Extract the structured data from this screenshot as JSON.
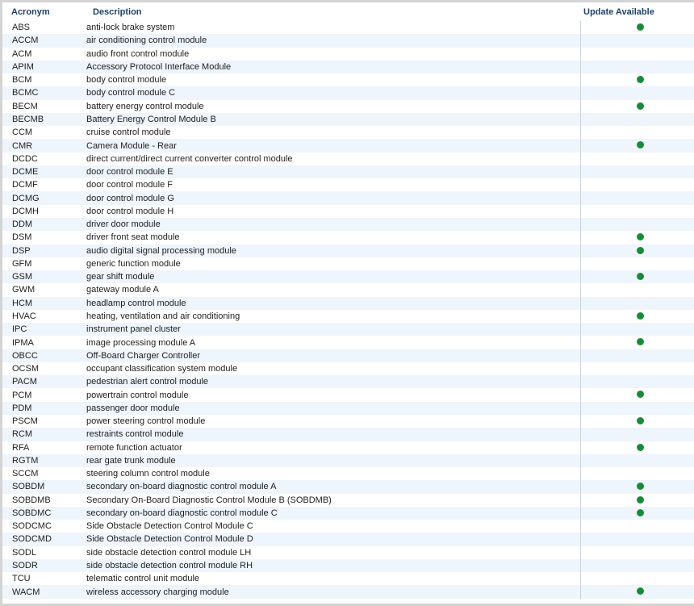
{
  "columns": {
    "acronym": "Acronym",
    "description": "Description",
    "update": "Update Available"
  },
  "colors": {
    "update_dot": "#1a8a3a",
    "header_text": "#1f3f66",
    "alt_row": "#eef5fc"
  },
  "rows": [
    {
      "acronym": "ABS",
      "description": "anti-lock brake system",
      "update": true
    },
    {
      "acronym": "ACCM",
      "description": "air conditioning control module",
      "update": false
    },
    {
      "acronym": "ACM",
      "description": "audio front control module",
      "update": false
    },
    {
      "acronym": "APIM",
      "description": "Accessory Protocol Interface Module",
      "update": false
    },
    {
      "acronym": "BCM",
      "description": "body control module",
      "update": true
    },
    {
      "acronym": "BCMC",
      "description": "body control module C",
      "update": false
    },
    {
      "acronym": "BECM",
      "description": "battery energy control module",
      "update": true
    },
    {
      "acronym": "BECMB",
      "description": "Battery Energy Control Module B",
      "update": false
    },
    {
      "acronym": "CCM",
      "description": "cruise control module",
      "update": false
    },
    {
      "acronym": "CMR",
      "description": "Camera Module - Rear",
      "update": true
    },
    {
      "acronym": "DCDC",
      "description": "direct current/direct current converter control module",
      "update": false
    },
    {
      "acronym": "DCME",
      "description": "door control module E",
      "update": false
    },
    {
      "acronym": "DCMF",
      "description": "door control module F",
      "update": false
    },
    {
      "acronym": "DCMG",
      "description": "door control module G",
      "update": false
    },
    {
      "acronym": "DCMH",
      "description": "door control module H",
      "update": false
    },
    {
      "acronym": "DDM",
      "description": "driver door module",
      "update": false
    },
    {
      "acronym": "DSM",
      "description": "driver front seat module",
      "update": true
    },
    {
      "acronym": "DSP",
      "description": "audio digital signal processing module",
      "update": true
    },
    {
      "acronym": "GFM",
      "description": "generic function module",
      "update": false
    },
    {
      "acronym": "GSM",
      "description": "gear shift module",
      "update": true
    },
    {
      "acronym": "GWM",
      "description": "gateway module A",
      "update": false
    },
    {
      "acronym": "HCM",
      "description": "headlamp control module",
      "update": false
    },
    {
      "acronym": "HVAC",
      "description": "heating, ventilation and air conditioning",
      "update": true
    },
    {
      "acronym": "IPC",
      "description": "instrument panel cluster",
      "update": false
    },
    {
      "acronym": "IPMA",
      "description": "image processing module A",
      "update": true
    },
    {
      "acronym": "OBCC",
      "description": "Off-Board Charger Controller",
      "update": false
    },
    {
      "acronym": "OCSM",
      "description": "occupant classification system module",
      "update": false
    },
    {
      "acronym": "PACM",
      "description": "pedestrian alert control module",
      "update": false
    },
    {
      "acronym": "PCM",
      "description": "powertrain control module",
      "update": true
    },
    {
      "acronym": "PDM",
      "description": "passenger door module",
      "update": false
    },
    {
      "acronym": "PSCM",
      "description": "power steering control module",
      "update": true
    },
    {
      "acronym": "RCM",
      "description": "restraints control module",
      "update": false
    },
    {
      "acronym": "RFA",
      "description": "remote function actuator",
      "update": true
    },
    {
      "acronym": "RGTM",
      "description": "rear gate trunk module",
      "update": false
    },
    {
      "acronym": "SCCM",
      "description": "steering column control module",
      "update": false
    },
    {
      "acronym": "SOBDM",
      "description": "secondary on-board diagnostic control module A",
      "update": true
    },
    {
      "acronym": "SOBDMB",
      "description": "Secondary On-Board Diagnostic Control Module B (SOBDMB)",
      "update": true
    },
    {
      "acronym": "SOBDMC",
      "description": "secondary on-board diagnostic control module C",
      "update": true
    },
    {
      "acronym": "SODCMC",
      "description": "Side Obstacle Detection Control Module C",
      "update": false
    },
    {
      "acronym": "SODCMD",
      "description": "Side Obstacle Detection Control Module D",
      "update": false
    },
    {
      "acronym": "SODL",
      "description": "side obstacle detection control module LH",
      "update": false
    },
    {
      "acronym": "SODR",
      "description": "side obstacle detection control module RH",
      "update": false
    },
    {
      "acronym": "TCU",
      "description": "telematic control unit module",
      "update": false
    },
    {
      "acronym": "WACM",
      "description": "wireless accessory charging module",
      "update": true
    }
  ]
}
